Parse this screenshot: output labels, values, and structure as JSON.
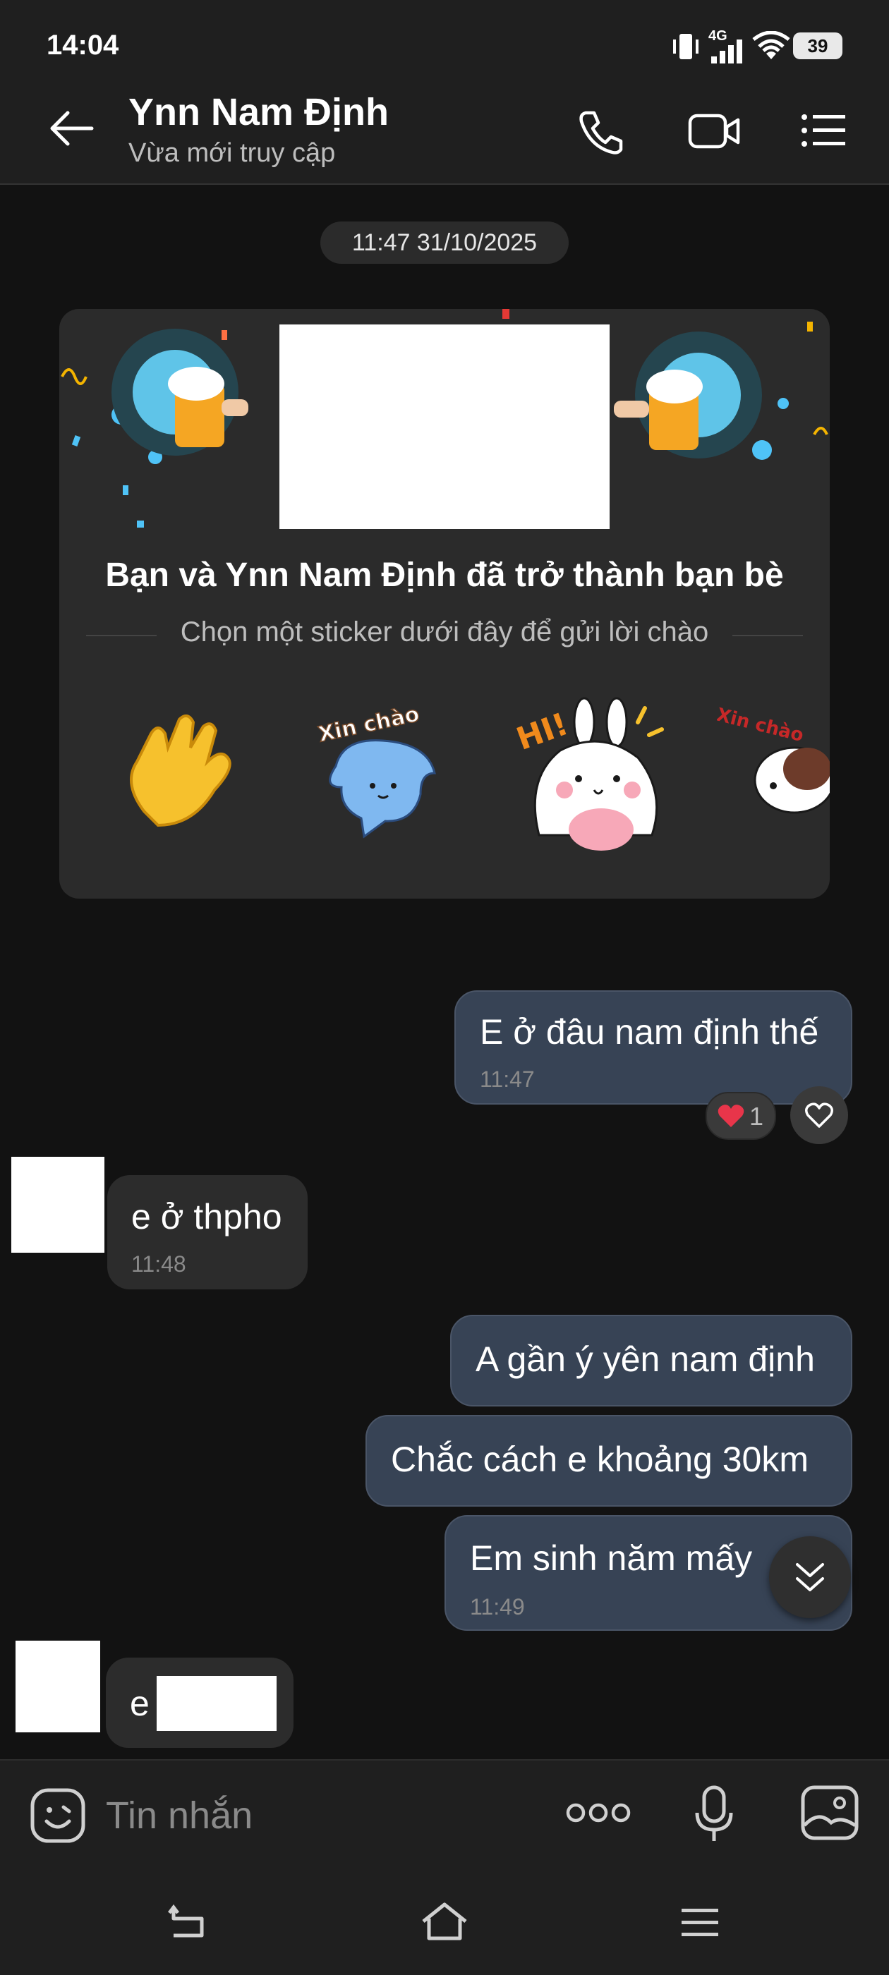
{
  "status_bar": {
    "time": "14:04",
    "network": "4G",
    "battery": "39"
  },
  "header": {
    "contact_name": "Ynn Nam Định",
    "contact_status": "Vừa mới truy cập"
  },
  "date_separator": "11:47 31/10/2025",
  "friend_card": {
    "title": "Bạn và Ynn Nam Định đã trở thành bạn bè",
    "subtitle": "Chọn một sticker dưới đây để gửi lời chào",
    "sticker_texts": [
      "Xin chào",
      "HI!",
      "Xin chào"
    ]
  },
  "messages": [
    {
      "direction": "out",
      "text": "E ở đâu nam định thế",
      "time": "11:47",
      "reaction": {
        "emoji": "❤️",
        "count": "1"
      }
    },
    {
      "direction": "in",
      "text": "e ở thpho",
      "time": "11:48"
    },
    {
      "direction": "out",
      "text": "A gần ý yên nam định",
      "time": ""
    },
    {
      "direction": "out",
      "text": "Chắc cách e khoảng 30km",
      "time": ""
    },
    {
      "direction": "out",
      "text": "Em sinh năm mấy",
      "time": "11:49"
    },
    {
      "direction": "in",
      "text": "e",
      "time": ""
    }
  ],
  "input": {
    "placeholder": "Tin nhắn"
  },
  "colors": {
    "outgoing_bubble": "#374355",
    "incoming_bubble": "#2c2c2c",
    "background": "#121212",
    "heart": "#e8354a"
  }
}
